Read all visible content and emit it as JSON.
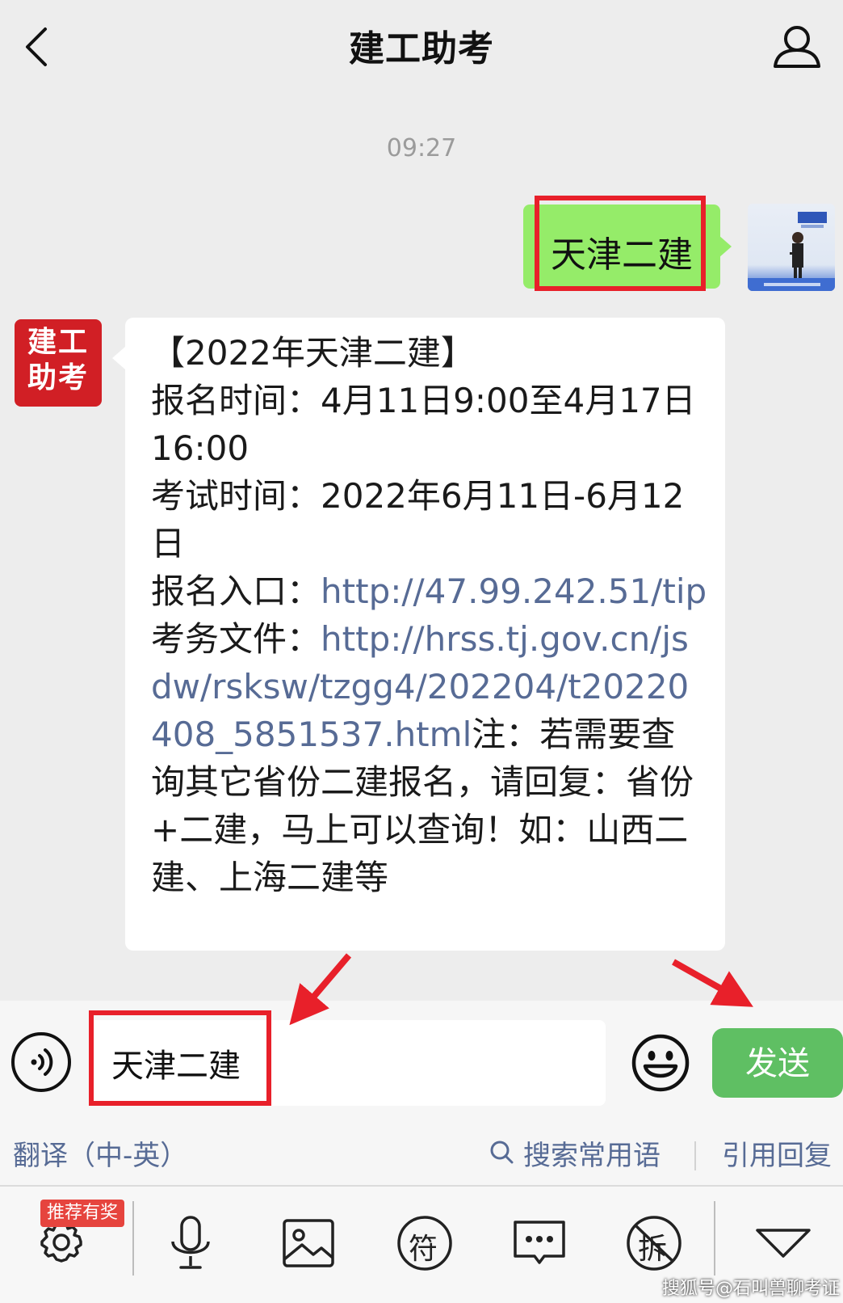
{
  "header": {
    "title": "建工助考",
    "back_icon": "chevron-left-icon",
    "profile_icon": "person-icon"
  },
  "chat": {
    "timestamp": "09:27",
    "sent": {
      "text": "天津二建",
      "bubble_color": "#95ec69"
    },
    "received": {
      "avatar_line1": "建工",
      "avatar_line2": "助考",
      "avatar_color": "#d11f25",
      "text_1": "【2022年天津二建】\n报名时间：4月11日9:00至4月17日16:00\n考试时间：2022年6月11日-6月12日\n报名入口：",
      "link_1": "http://47.99.242.51/tip",
      "text_2": "\n考务文件：",
      "link_2": "http://hrss.tj.gov.cn/jsdw/rsksw/tzgg4/202204/t20220408_5851537.html",
      "text_3": "注：若需要查询其它省份二建报名，请回复：省份+二建，马上可以查询！如：山西二建、上海二建等"
    }
  },
  "input_bar": {
    "input_value": "天津二建",
    "send_label": "发送",
    "send_color": "#5fbf63"
  },
  "suggestions": {
    "translate": "翻译（中-英）",
    "search": "搜索常用语",
    "quote": "引用回复"
  },
  "tools": {
    "badge": "推荐有奖",
    "icons": [
      "settings-icon",
      "microphone-icon",
      "image-icon",
      "symbol-icon",
      "chat-bubble-icon",
      "dismantle-icon",
      "collapse-icon"
    ],
    "symbol_char": "符",
    "dismantle_char": "拆"
  },
  "watermark": "搜狐号@石叫兽聊考证",
  "annotation_color": "#e8202a",
  "link_color": "#576b95"
}
